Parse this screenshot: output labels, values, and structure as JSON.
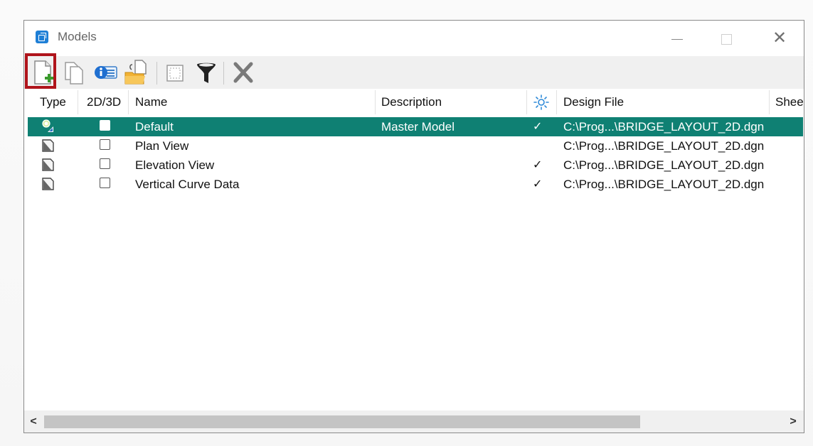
{
  "window": {
    "title": "Models",
    "controls": {
      "minimize": "—",
      "maximize": "",
      "close": "✕"
    }
  },
  "toolbar": {
    "buttons": [
      {
        "name": "create-model",
        "icon": "new-model-icon",
        "highlighted": true
      },
      {
        "name": "copy-model",
        "icon": "copy-icon"
      },
      {
        "name": "edit-properties",
        "icon": "properties-icon"
      },
      {
        "name": "import-model",
        "icon": "import-folder-icon"
      },
      {
        "name": "select-model",
        "icon": "select-box-icon"
      },
      {
        "name": "filter",
        "icon": "filter-icon"
      },
      {
        "name": "delete",
        "icon": "delete-x-icon"
      }
    ]
  },
  "columns": {
    "type": "Type",
    "dim": "2D/3D",
    "name": "Name",
    "description": "Description",
    "design_file": "Design File",
    "sheet": "Shee"
  },
  "rows": [
    {
      "name": "Default",
      "description": "Master Model",
      "tick": "✓",
      "design_file": "C:\\Prog...\\BRIDGE_LAYOUT_2D.dgn",
      "selected": true
    },
    {
      "name": "Plan View",
      "description": "",
      "tick": "",
      "design_file": "C:\\Prog...\\BRIDGE_LAYOUT_2D.dgn",
      "selected": false
    },
    {
      "name": "Elevation View",
      "description": "",
      "tick": "✓",
      "design_file": "C:\\Prog...\\BRIDGE_LAYOUT_2D.dgn",
      "selected": false
    },
    {
      "name": "Vertical Curve Data",
      "description": "",
      "tick": "✓",
      "design_file": "C:\\Prog...\\BRIDGE_LAYOUT_2D.dgn",
      "selected": false
    }
  ],
  "scrollbar": {
    "left": "<",
    "right": ">"
  },
  "colors": {
    "selection": "#0f8073",
    "highlight": "#b0141b",
    "accent": "#1e7fd6"
  }
}
